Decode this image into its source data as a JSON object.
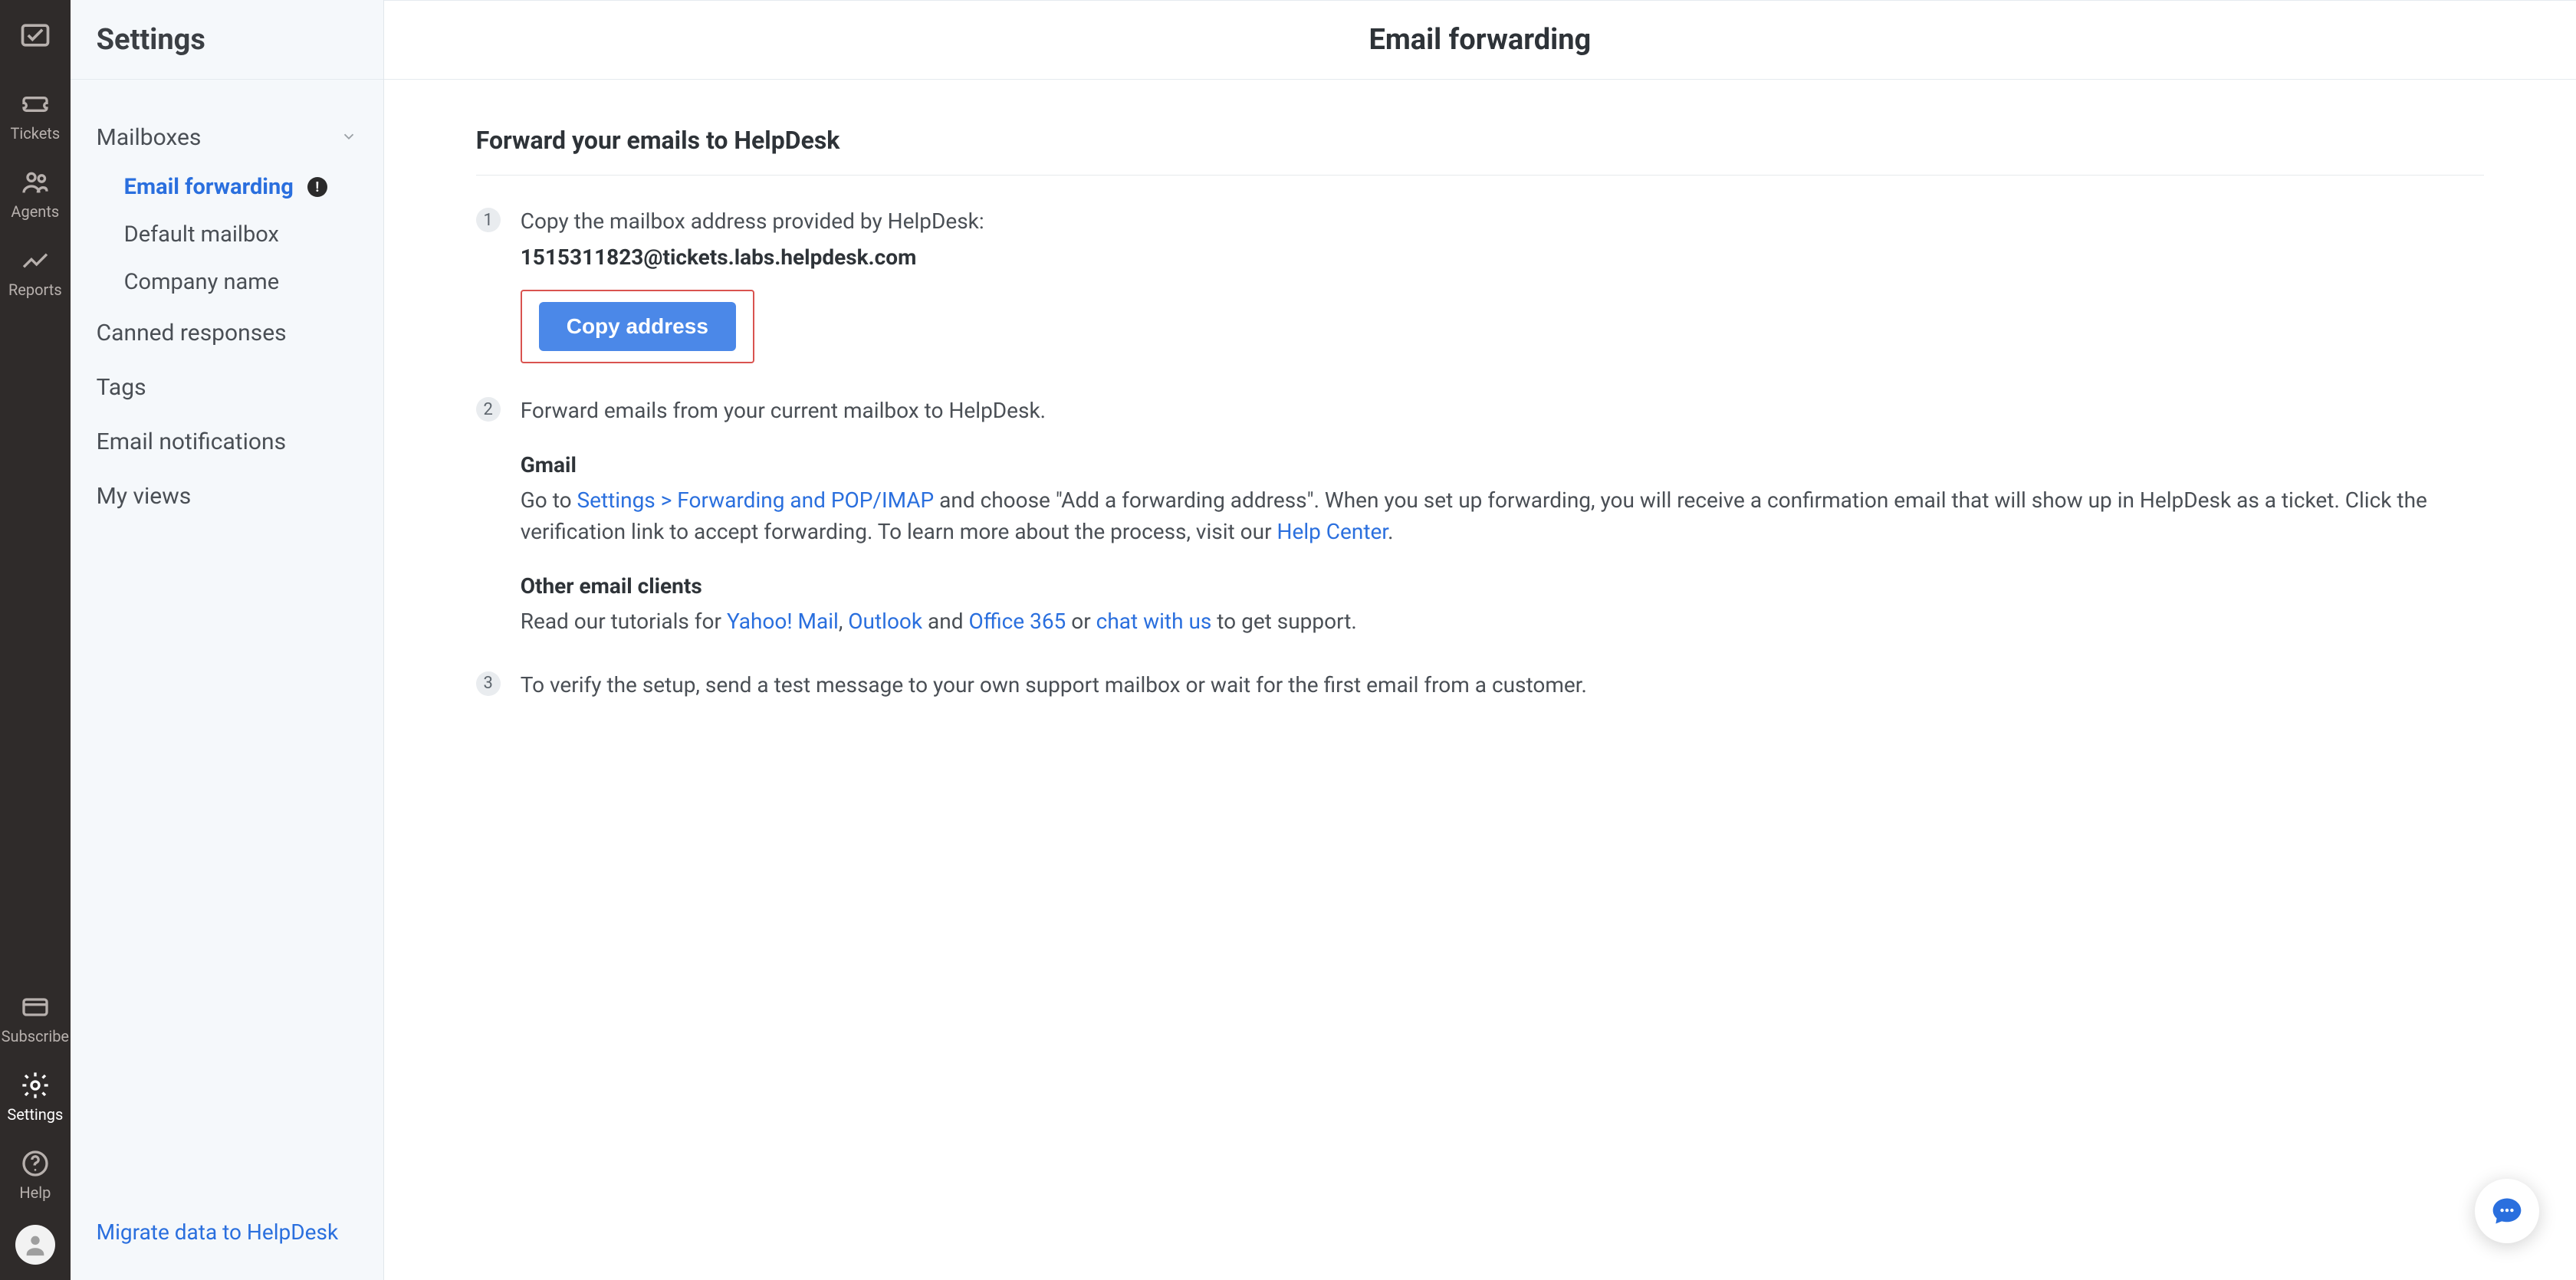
{
  "navrail": {
    "items": [
      {
        "label": "Tickets"
      },
      {
        "label": "Agents"
      },
      {
        "label": "Reports"
      }
    ],
    "bottom": [
      {
        "label": "Subscribe"
      },
      {
        "label": "Settings"
      },
      {
        "label": "Help"
      }
    ]
  },
  "sidepanel": {
    "title": "Settings",
    "mailboxes": {
      "label": "Mailboxes",
      "children": {
        "email_forwarding": {
          "label": "Email forwarding",
          "badge": "!"
        },
        "default_mailbox": {
          "label": "Default mailbox"
        },
        "company_name": {
          "label": "Company name"
        }
      }
    },
    "canned_responses": {
      "label": "Canned responses"
    },
    "tags": {
      "label": "Tags"
    },
    "email_notifications": {
      "label": "Email notifications"
    },
    "my_views": {
      "label": "My views"
    },
    "footer_link": "Migrate data to HelpDesk"
  },
  "main": {
    "page_title": "Email forwarding",
    "section_heading": "Forward your emails to HelpDesk",
    "step1": {
      "num": "1",
      "text": "Copy the mailbox address provided by HelpDesk:",
      "address": "1515311823@tickets.labs.helpdesk.com",
      "copy_button": "Copy address"
    },
    "step2": {
      "num": "2",
      "text": "Forward emails from your current mailbox to HelpDesk.",
      "gmail": {
        "title": "Gmail",
        "prefix": "Go to ",
        "link1": "Settings > Forwarding and POP/IMAP",
        "after_link1": " and choose \"Add a forwarding address\". When you set up forwarding, you will receive a confirmation email that will show up in HelpDesk as a ticket. Click the verification link to accept forwarding. To learn more about the process, visit our ",
        "help_center": "Help Center",
        "period": "."
      },
      "other": {
        "title": "Other email clients",
        "prefix": "Read our tutorials for ",
        "yahoo": "Yahoo! Mail",
        "comma": ", ",
        "outlook": "Outlook",
        "and": " and ",
        "office365": "Office 365",
        "or": " or ",
        "chat": "chat with us",
        "suffix": " to get support."
      }
    },
    "step3": {
      "num": "3",
      "text": "To verify the setup, send a test message to your own support mailbox or wait for the first email from a customer."
    }
  }
}
